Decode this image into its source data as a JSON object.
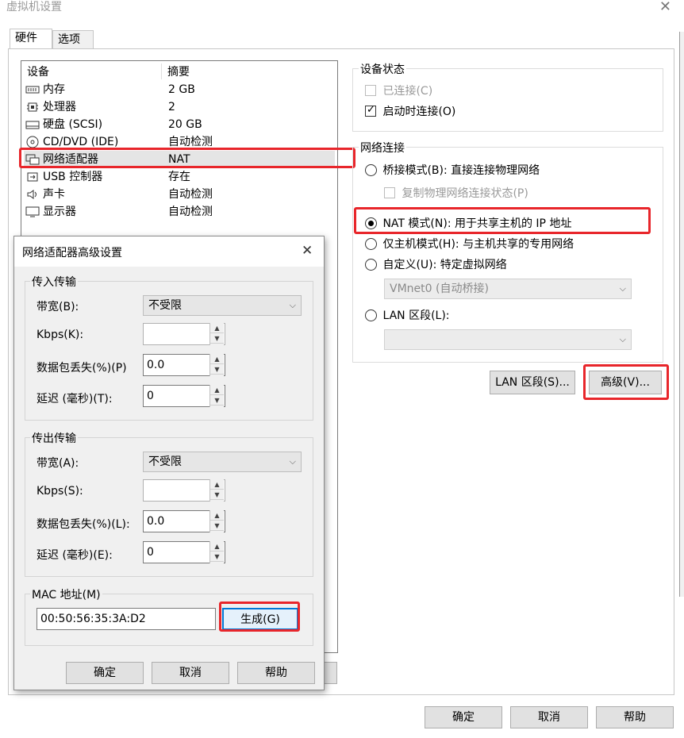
{
  "window": {
    "title": "虚拟机设置",
    "close_glyph": "✕"
  },
  "tabs": [
    {
      "label": "硬件"
    },
    {
      "label": "选项"
    }
  ],
  "device_list": {
    "headers": {
      "device": "设备",
      "summary": "摘要"
    },
    "rows": [
      {
        "name": "内存",
        "value": "2 GB",
        "icon": "memory-icon"
      },
      {
        "name": "处理器",
        "value": "2",
        "icon": "cpu-icon"
      },
      {
        "name": "硬盘 (SCSI)",
        "value": "20 GB",
        "icon": "hard-disk-icon"
      },
      {
        "name": "CD/DVD (IDE)",
        "value": "自动检测",
        "icon": "cd-dvd-icon"
      },
      {
        "name": "网络适配器",
        "value": "NAT",
        "icon": "network-adapter-icon"
      },
      {
        "name": "USB 控制器",
        "value": "存在",
        "icon": "usb-icon"
      },
      {
        "name": "声卡",
        "value": "自动检测",
        "icon": "speaker-icon"
      },
      {
        "name": "显示器",
        "value": "自动检测",
        "icon": "monitor-icon"
      }
    ]
  },
  "device_status": {
    "title": "设备状态",
    "connected": {
      "label": "已连接(C)",
      "checked": false,
      "disabled": true
    },
    "connect_at_power_on": {
      "label": "启动时连接(O)",
      "checked": true
    }
  },
  "network_connection": {
    "title": "网络连接",
    "bridged": {
      "label": "桥接模式(B): 直接连接物理网络",
      "selected": false
    },
    "replicate": {
      "label": "复制物理网络连接状态(P)",
      "checked": false,
      "disabled": true
    },
    "nat": {
      "label": "NAT 模式(N): 用于共享主机的 IP 地址",
      "selected": true
    },
    "host_only": {
      "label": "仅主机模式(H): 与主机共享的专用网络",
      "selected": false
    },
    "custom": {
      "label": "自定义(U): 特定虚拟网络",
      "selected": false
    },
    "custom_select_value": "VMnet0 (自动桥接)",
    "lan_segment": {
      "label": "LAN 区段(L):",
      "selected": false
    },
    "lan_segment_select_value": ""
  },
  "buttons": {
    "lan_segments": "LAN 区段(S)...",
    "advanced": "高级(V)...",
    "ok": "确定",
    "cancel": "取消",
    "help": "帮助"
  },
  "advanced_dialog": {
    "title": "网络适配器高级设置",
    "close_glyph": "✕",
    "incoming": {
      "title": "传入传输",
      "bandwidth_label": "带宽(B):",
      "bandwidth_value": "不受限",
      "kbps_label": "Kbps(K):",
      "kbps_value": "",
      "packet_loss_label": "数据包丢失(%)(P)",
      "packet_loss_value": "0.0",
      "latency_label": "延迟 (毫秒)(T):",
      "latency_value": "0"
    },
    "outgoing": {
      "title": "传出传输",
      "bandwidth_label": "带宽(A):",
      "bandwidth_value": "不受限",
      "kbps_label": "Kbps(S):",
      "kbps_value": "",
      "packet_loss_label": "数据包丢失(%)(L):",
      "packet_loss_value": "0.0",
      "latency_label": "延迟 (毫秒)(E):",
      "latency_value": "0"
    },
    "mac": {
      "title": "MAC 地址(M)",
      "value": "00:50:56:35:3A:D2",
      "generate_label": "生成(G)"
    },
    "buttons": {
      "ok": "确定",
      "cancel": "取消",
      "help": "帮助"
    }
  },
  "colors": {
    "highlight": "#e8262b",
    "selected_row": "#e5e5e5"
  }
}
